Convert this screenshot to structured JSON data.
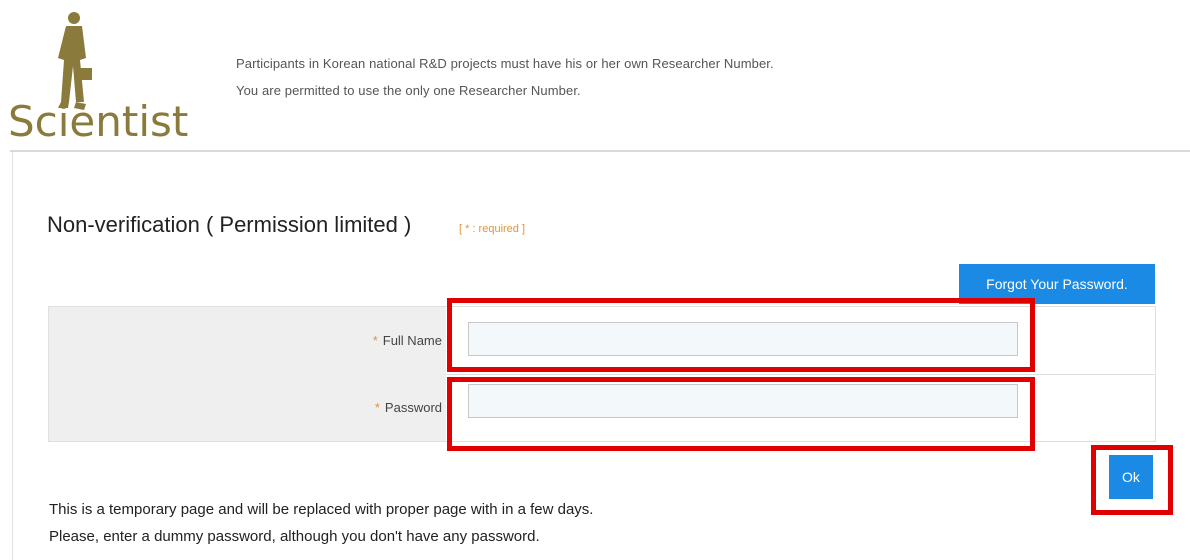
{
  "header": {
    "logo_text": "Scientist",
    "notice_lines": [
      "Participants in Korean national R&D projects must have his or her own Researcher Number.",
      "You are permitted to use the only one Researcher Number."
    ]
  },
  "form": {
    "title": "Non-verification ( Permission limited )",
    "required_note": "[ * : required ]",
    "forgot_button": "Forgot Your Password.",
    "required_mark": "*",
    "fields": [
      {
        "label": "Full Name",
        "value": ""
      },
      {
        "label": "Password",
        "value": ""
      }
    ],
    "ok_button": "Ok"
  },
  "footer": {
    "lines": [
      "This is a temporary page and will be replaced with proper page with in a few days.",
      "Please, enter a dummy password, although you don't have any password."
    ]
  },
  "colors": {
    "primary_button": "#1a8ae5",
    "highlight": "#e00000",
    "required_accent": "#e0943a",
    "logo_gold": "#8a7a3c"
  }
}
